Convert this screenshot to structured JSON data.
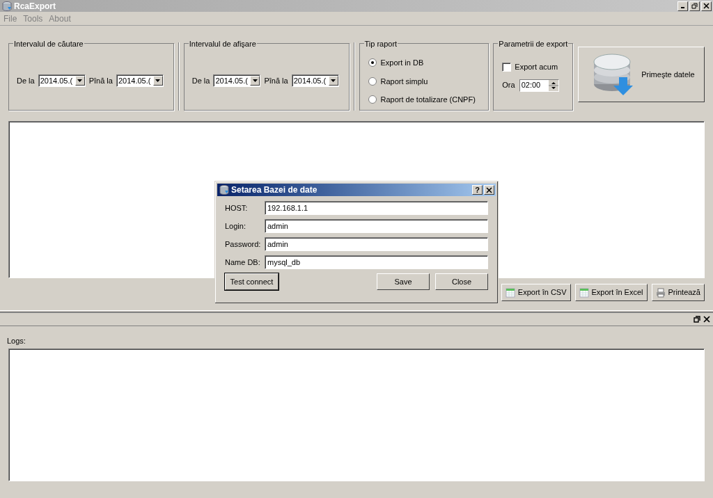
{
  "window": {
    "title": "RcaExport"
  },
  "menu": [
    "File",
    "Tools",
    "About"
  ],
  "search_interval": {
    "title": "Intervalul de căutare",
    "from_label": "De la",
    "from": "2014.05.(",
    "to_label": "Pînă la",
    "to": "2014.05.("
  },
  "display_interval": {
    "title": "Intervalul de afişare",
    "from_label": "De la",
    "from": "2014.05.(",
    "to_label": "Pînă la",
    "to": "2014.05.("
  },
  "report_type": {
    "title": "Tip raport",
    "options": [
      {
        "label": "Export in DB",
        "selected": true
      },
      {
        "label": "Raport simplu",
        "selected": false
      },
      {
        "label": "Raport de totalizare (CNPF)",
        "selected": false
      }
    ]
  },
  "export_params": {
    "title": "Parametrii de export",
    "export_now": {
      "label": "Export acum",
      "checked": false
    },
    "time_label": "Ora",
    "time": "02:00"
  },
  "fetch_button": "Primeşte datele",
  "action_buttons": [
    {
      "label": "Export în CSV",
      "kind": "sheet"
    },
    {
      "label": "Export în Excel",
      "kind": "sheet"
    },
    {
      "label": "Printează",
      "kind": "print"
    }
  ],
  "logs_label": "Logs:",
  "dialog": {
    "title": "Setarea Bazei de date",
    "help": "?",
    "fields": [
      {
        "label": "HOST:",
        "value": "192.168.1.1"
      },
      {
        "label": "Login:",
        "value": "admin"
      },
      {
        "label": "Password:",
        "value": "admin"
      },
      {
        "label": "Name DB:",
        "value": "mysql_db"
      }
    ],
    "buttons": [
      "Test connect",
      "Save",
      "Close"
    ]
  }
}
